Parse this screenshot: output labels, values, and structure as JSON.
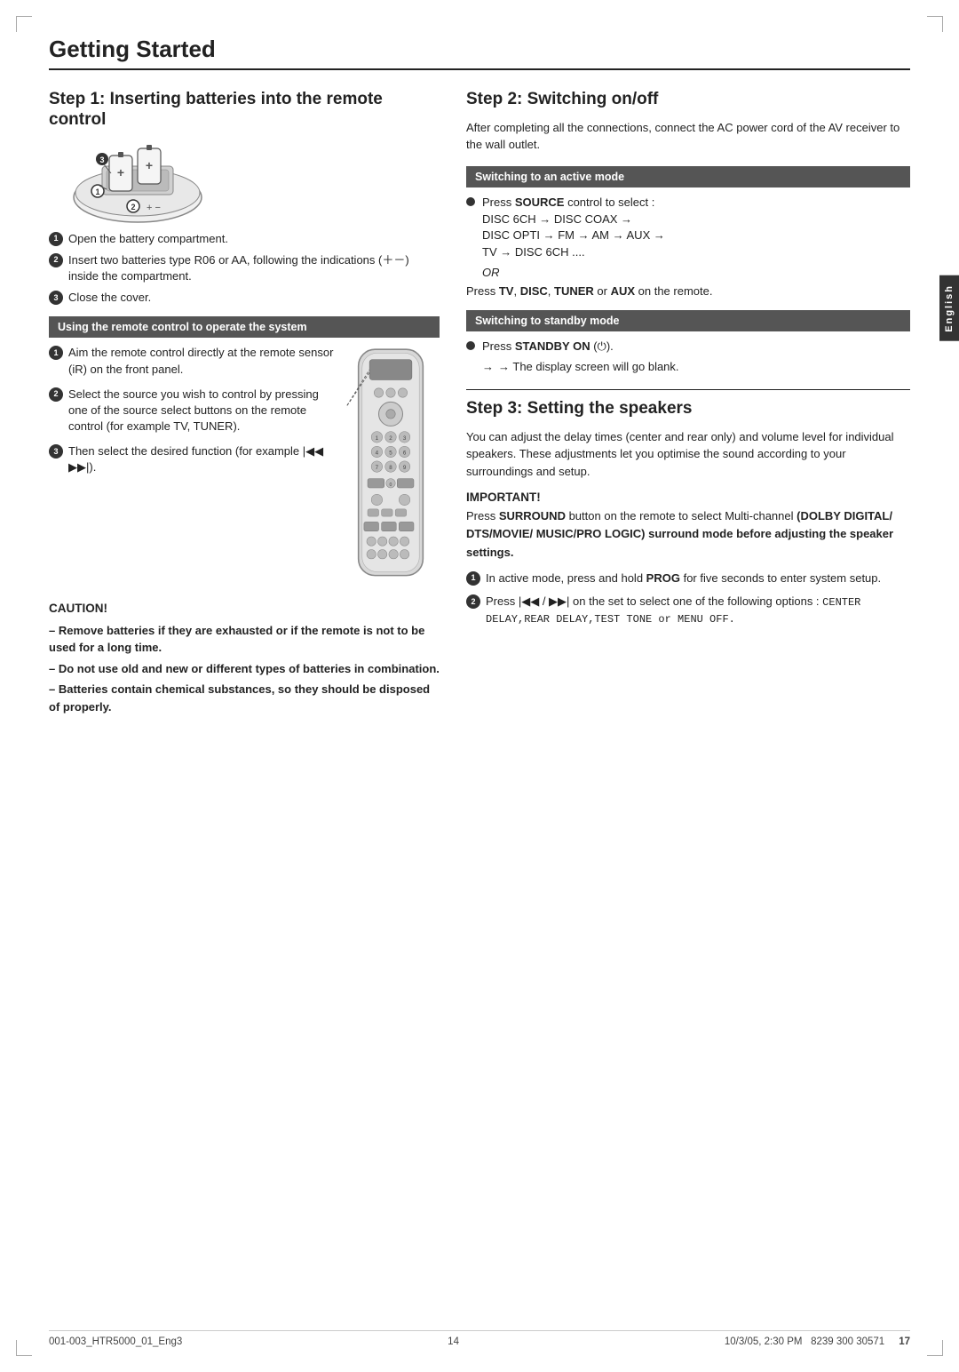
{
  "page": {
    "title": "Getting Started",
    "footer": {
      "left": "001-003_HTR5000_01_Eng3",
      "center": "14",
      "right_date": "10/3/05, 2:30 PM",
      "model": "8239 300 30571",
      "page_number": "17"
    },
    "english_tab": "English"
  },
  "step1": {
    "heading": "Step 1:  Inserting batteries into the remote control",
    "items": [
      "Open the battery compartment.",
      "Insert two batteries type R06 or AA, following the indications (＋－) inside the compartment.",
      "Close the cover."
    ],
    "section_header": "Using the remote control to operate the system",
    "operate_items": [
      "Aim the remote control directly at the remote sensor (iR) on the front panel.",
      "Select the source you wish to control by pressing one of the source select buttons on the remote control (for example TV, TUNER).",
      "Then select the desired function (for example |◀◀  ▶▶|)."
    ],
    "caution_title": "CAUTION!",
    "caution_items": [
      "– Remove batteries if they are exhausted or if the remote is not to be used for a long time.",
      "– Do not use old and new or different types of batteries in combination.",
      "– Batteries contain chemical substances, so they should be disposed of properly."
    ]
  },
  "step2": {
    "heading": "Step 2:  Switching on/off",
    "intro": "After completing all the connections, connect the AC power cord of the AV receiver to the wall outlet.",
    "active_header": "Switching to an active mode",
    "active_items": [
      {
        "prefix": "Press the ",
        "bold": "SOURCE",
        "suffix": " control to select :"
      }
    ],
    "active_source_list": "DISC 6CH → DISC COAX → DISC OPTI → FM → AM → AUX → TV → DISC 6CH ....",
    "active_or": "OR",
    "active_tv_disc": "Press TV, DISC, TUNER or AUX on the remote.",
    "standby_header": "Switching to standby mode",
    "standby_item": "Press STANDBY ON (⏻).",
    "standby_arrow": "→ The display screen will go blank."
  },
  "step3": {
    "heading": "Step 3:  Setting the speakers",
    "intro": "You can adjust the delay times (center and rear only) and volume level for individual speakers. These adjustments let you optimise the sound according to your surroundings and setup.",
    "important_title": "IMPORTANT!",
    "important_text": "Press SURROUND button on the remote to select Multi-channel (DOLBY DIGITAL/ DTS/MOVIE/ MUSIC/PRO LOGIC) surround mode before adjusting the speaker settings.",
    "active_steps": [
      "In active mode, press and hold PROG for five seconds to enter system setup.",
      "Press |◀◀ / ▶▶| on the set to select one of the following options :"
    ],
    "menu_options": "CENTER DELAY,REAR DELAY,TEST TONE or MENU OFF."
  }
}
